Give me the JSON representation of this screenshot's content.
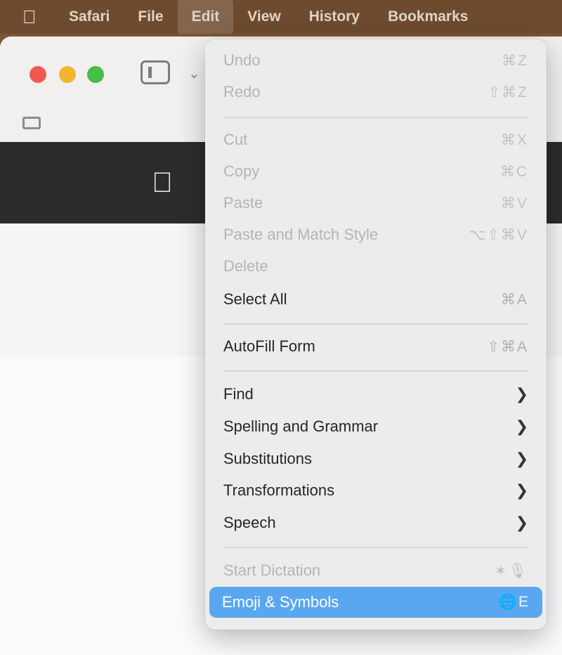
{
  "menubar": {
    "apple_icon": "apple-icon",
    "items": [
      "Safari",
      "File",
      "Edit",
      "View",
      "History",
      "Bookmarks"
    ],
    "active": "Edit"
  },
  "window": {
    "banner_logo_icon": "apple-logo-icon"
  },
  "edit_menu": {
    "undo": {
      "label": "Undo",
      "shortcut": "⌘Z"
    },
    "redo": {
      "label": "Redo",
      "shortcut": "⇧⌘Z"
    },
    "cut": {
      "label": "Cut",
      "shortcut": "⌘X"
    },
    "copy": {
      "label": "Copy",
      "shortcut": "⌘C"
    },
    "paste": {
      "label": "Paste",
      "shortcut": "⌘V"
    },
    "paste_match": {
      "label": "Paste and Match Style",
      "shortcut": "⌥⇧⌘V"
    },
    "delete": {
      "label": "Delete"
    },
    "select_all": {
      "label": "Select All",
      "shortcut": "⌘A"
    },
    "autofill": {
      "label": "AutoFill Form",
      "shortcut": "⇧⌘A"
    },
    "find": {
      "label": "Find",
      "arrow": "❯"
    },
    "spelling": {
      "label": "Spelling and Grammar",
      "arrow": "❯"
    },
    "substitutions": {
      "label": "Substitutions",
      "arrow": "❯"
    },
    "transformations": {
      "label": "Transformations",
      "arrow": "❯"
    },
    "speech": {
      "label": "Speech",
      "arrow": "❯"
    },
    "dictation": {
      "label": "Start Dictation",
      "shortcut": "✶🎙"
    },
    "emoji": {
      "label": "Emoji & Symbols",
      "shortcut": "🌐E"
    }
  }
}
